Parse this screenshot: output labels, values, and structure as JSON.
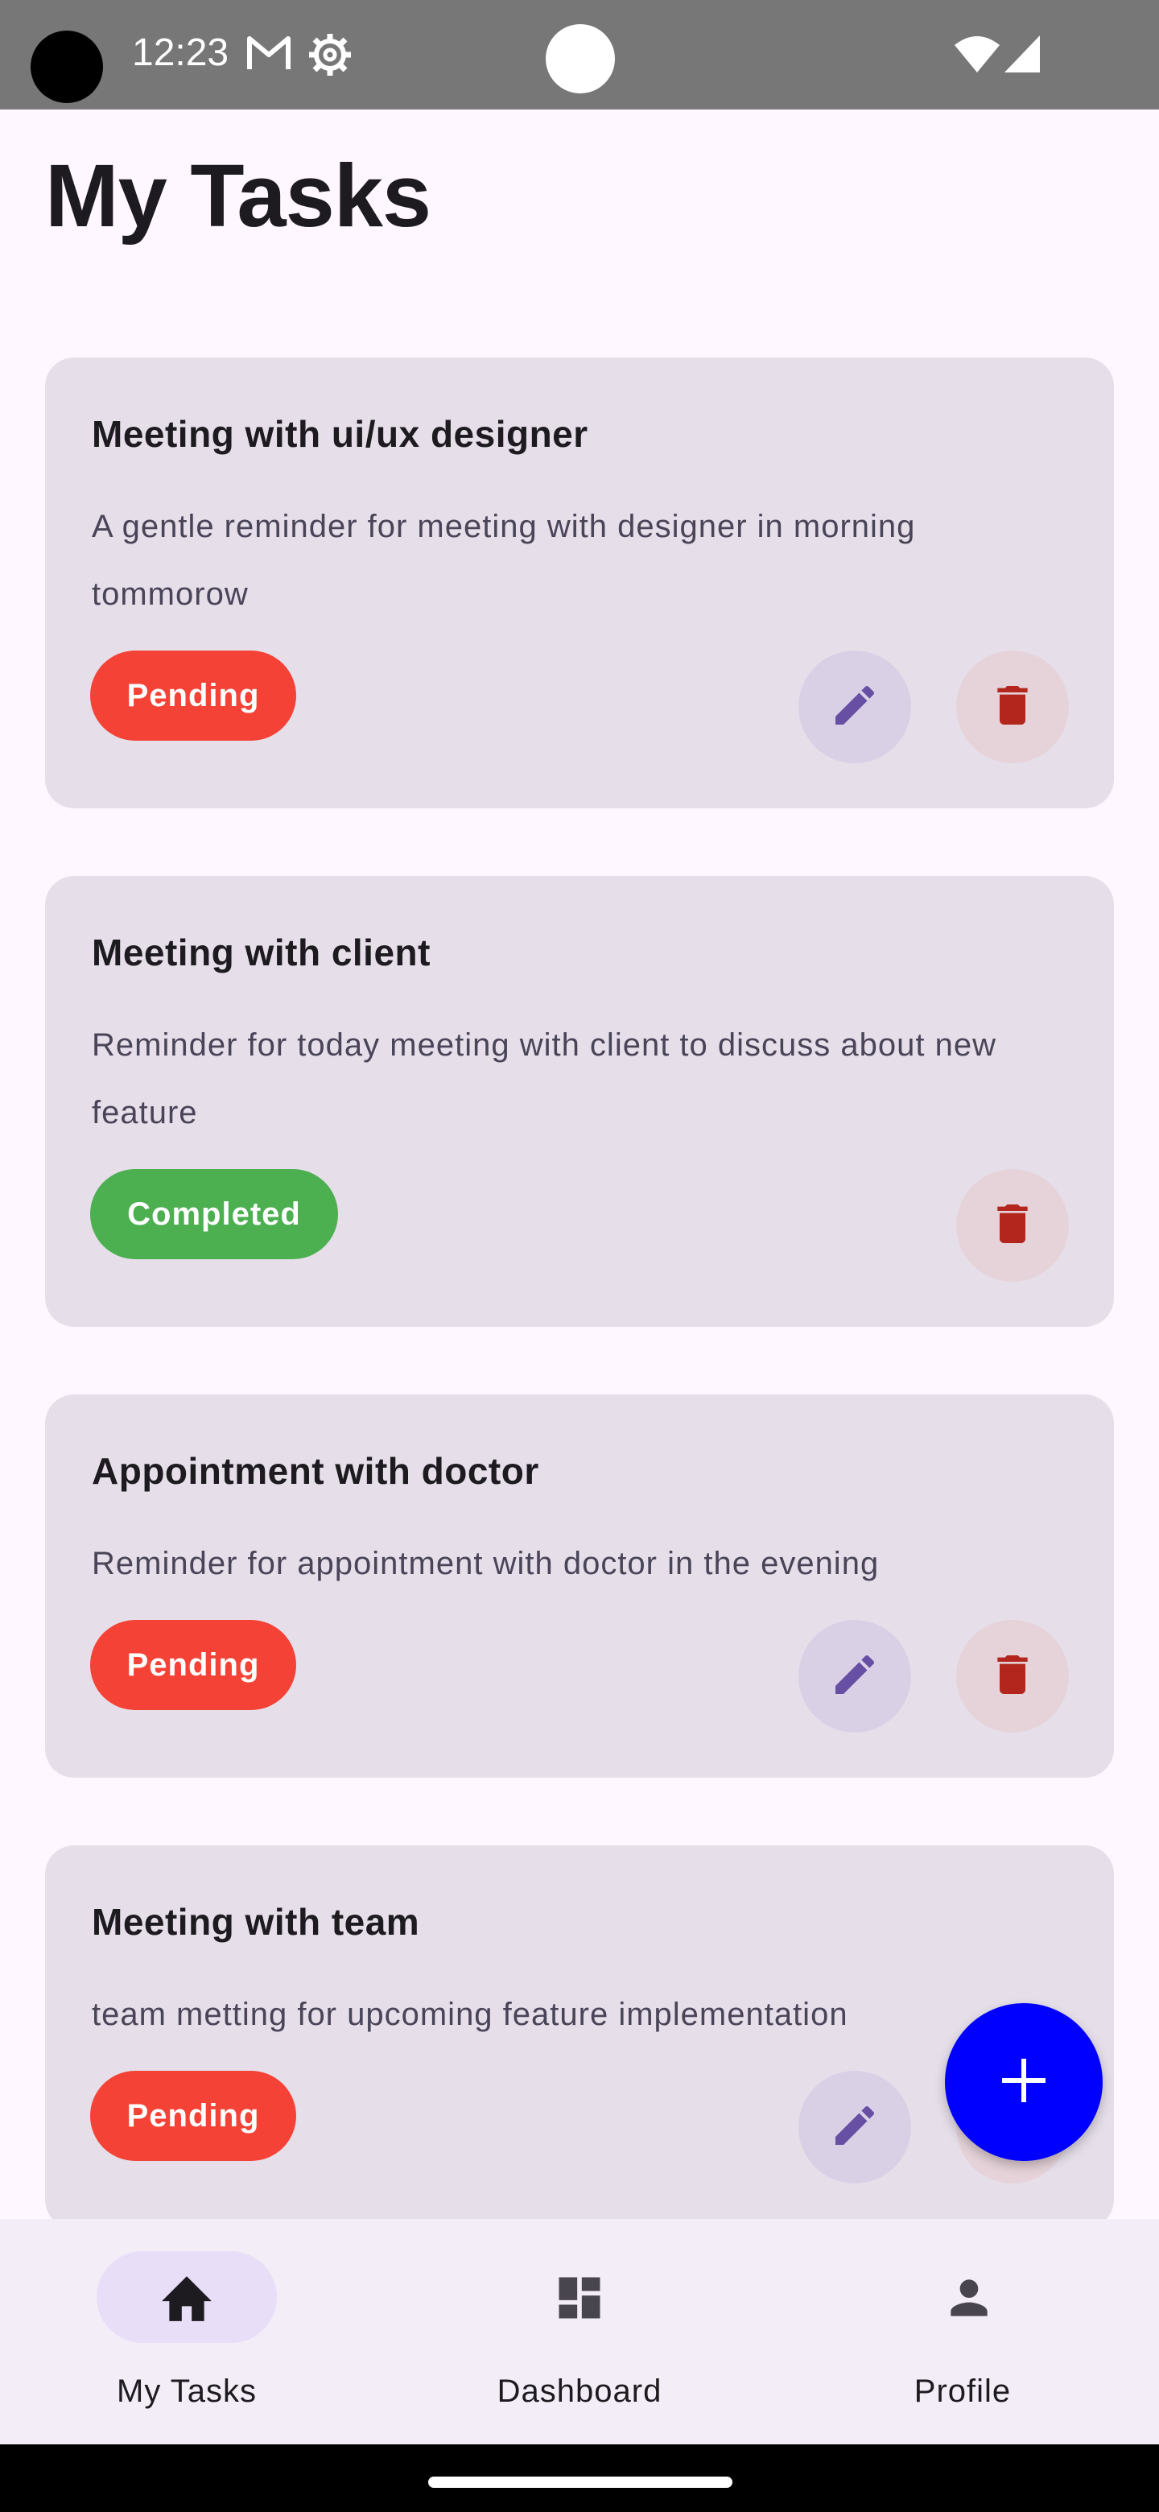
{
  "status_bar": {
    "time": "12:23",
    "icons": [
      "gmail-icon",
      "settings-gear-icon",
      "wifi-icon",
      "signal-icon"
    ]
  },
  "header": {
    "title": "My Tasks"
  },
  "tasks": [
    {
      "title": "Meeting with ui/ux designer",
      "description": "A gentle reminder for meeting with designer in morning tommorow",
      "status": "Pending",
      "actions": [
        "edit",
        "delete"
      ]
    },
    {
      "title": "Meeting with client",
      "description": "Reminder for today meeting with client to discuss about new feature",
      "status": "Completed",
      "actions": [
        "delete"
      ]
    },
    {
      "title": "Appointment with doctor",
      "description": "Reminder for appointment with doctor in the evening",
      "status": "Pending",
      "actions": [
        "edit",
        "delete"
      ]
    },
    {
      "title": "Meeting with team",
      "description": "team metting for upcoming feature implementation",
      "status": "Pending",
      "actions": [
        "edit",
        "delete"
      ]
    }
  ],
  "fab": {
    "icon": "add-icon"
  },
  "bottom_nav": {
    "items": [
      {
        "label": "My Tasks",
        "icon": "home-icon",
        "selected": true
      },
      {
        "label": "Dashboard",
        "icon": "dashboard-icon",
        "selected": false
      },
      {
        "label": "Profile",
        "icon": "person-icon",
        "selected": false
      }
    ]
  },
  "colors": {
    "background": "#fef7ff",
    "card": "#e6dfea",
    "pending": "#f44336",
    "completed": "#4caf50",
    "fab": "#0000ff",
    "edit_icon": "#6750a4",
    "delete_icon": "#b3261e",
    "nav_background": "#f3edf7",
    "nav_selected_pill": "#e8def8"
  }
}
